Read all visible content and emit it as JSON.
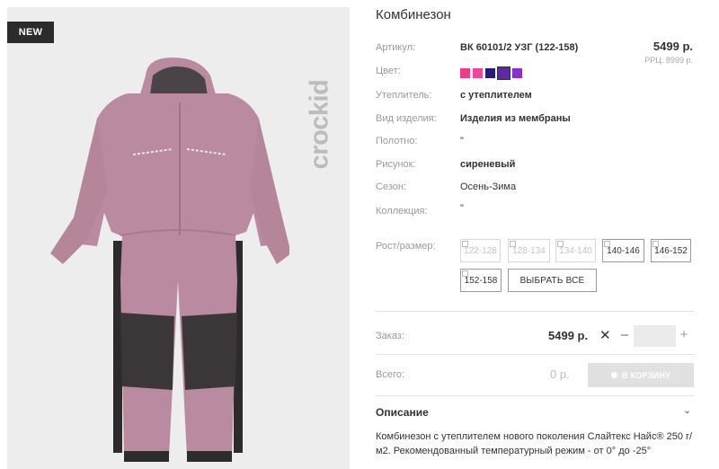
{
  "product": {
    "badge": "NEW",
    "brand": "crockid",
    "title": "Комбинезон",
    "price": "5499 р.",
    "rrp": "РРЦ: 8999 р."
  },
  "specs": [
    {
      "label": "Артикул:",
      "value": "ВК 60101/2 УЗГ (122-158)",
      "bold": true
    },
    {
      "label": "Цвет:",
      "value": ""
    },
    {
      "label": "Утеплитель:",
      "value": "с утеплителем",
      "bold": true
    },
    {
      "label": "Вид изделия:",
      "value": "Изделия из мембраны",
      "bold": true
    },
    {
      "label": "Полотно:",
      "value": "\""
    },
    {
      "label": "Рисунок:",
      "value": "сиреневый",
      "bold": true
    },
    {
      "label": "Сезон:",
      "value": "Осень-Зима"
    },
    {
      "label": "Коллекция:",
      "value": "\""
    }
  ],
  "colors": [
    "#ee3b8a",
    "#f0479b",
    "#241b7c",
    "#5f2aa1",
    "#8a2fc9"
  ],
  "selected_color_index": 3,
  "sizes": {
    "label": "Рост/размер:",
    "options": [
      {
        "label": "122-128",
        "available": false
      },
      {
        "label": "128-134",
        "available": false
      },
      {
        "label": "134-140",
        "available": false
      },
      {
        "label": "140-146",
        "available": true
      },
      {
        "label": "146-152",
        "available": true
      },
      {
        "label": "152-158",
        "available": true
      }
    ],
    "select_all": "ВЫБРАТЬ ВСЕ"
  },
  "order": {
    "label": "Заказ:",
    "price": "5499 р.",
    "times": "✕",
    "minus": "–",
    "plus": "+",
    "quantity": ""
  },
  "total": {
    "label": "Всего:",
    "value": "0 р.",
    "cart_button": "В КОРЗИНУ"
  },
  "description": {
    "heading": "Описание",
    "text": "Комбинезон с утеплителем нового поколения Слайтекс Найс® 250 г/м2. Рекомендованный температурный режим - от 0° до -25°"
  }
}
